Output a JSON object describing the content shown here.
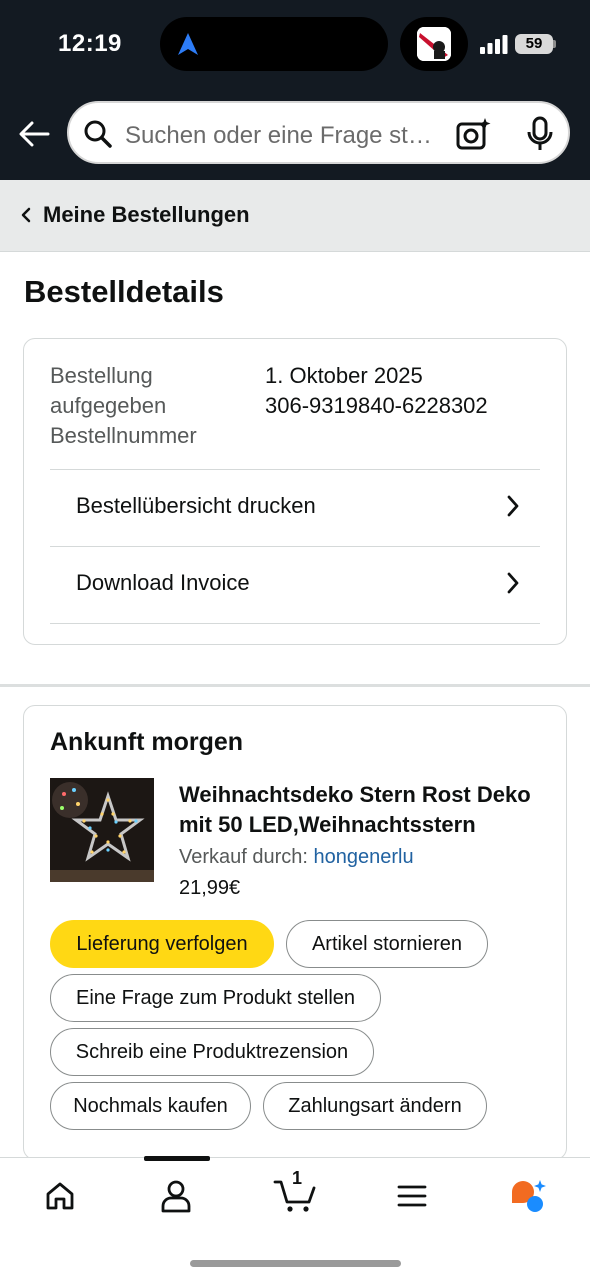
{
  "status_bar": {
    "time": "12:19",
    "battery": "59"
  },
  "search": {
    "placeholder": "Suchen oder eine Frage stellen"
  },
  "breadcrumb": {
    "label": "Meine Bestellungen"
  },
  "page": {
    "title": "Bestelldetails"
  },
  "order_info": {
    "label_lines": [
      "Bestellung",
      "aufgegeben",
      "Bestellnummer"
    ],
    "date": "1. Oktober 2025",
    "order_number": "306-9319840-6228302",
    "links": [
      {
        "label": "Bestellübersicht drucken"
      },
      {
        "label": "Download Invoice"
      }
    ]
  },
  "shipment": {
    "title": "Ankunft morgen",
    "product": {
      "title": "Weihnachtsdeko Stern Rost Deko mit 50 LED,Weihnachtsstern",
      "seller_prefix": "Verkauf durch:",
      "seller": "hongenerlu",
      "price": "21,99€"
    },
    "actions": [
      {
        "label": "Lieferung verfolgen"
      },
      {
        "label": "Artikel stornieren"
      },
      {
        "label": "Eine Frage zum Produkt stellen"
      },
      {
        "label": "Schreib eine Produktrezension"
      },
      {
        "label": "Nochmals kaufen"
      },
      {
        "label": "Zahlungsart ändern"
      }
    ]
  },
  "tabbar": {
    "cart_count": "1",
    "tabs": [
      "home-icon",
      "account-icon",
      "cart-icon",
      "menu-icon",
      "rufus-icon"
    ]
  },
  "colors": {
    "header_bg": "#131a22",
    "primary_button": "#ffd814",
    "link": "#2162a1",
    "breadcrumb_bg": "#e8eaea"
  }
}
